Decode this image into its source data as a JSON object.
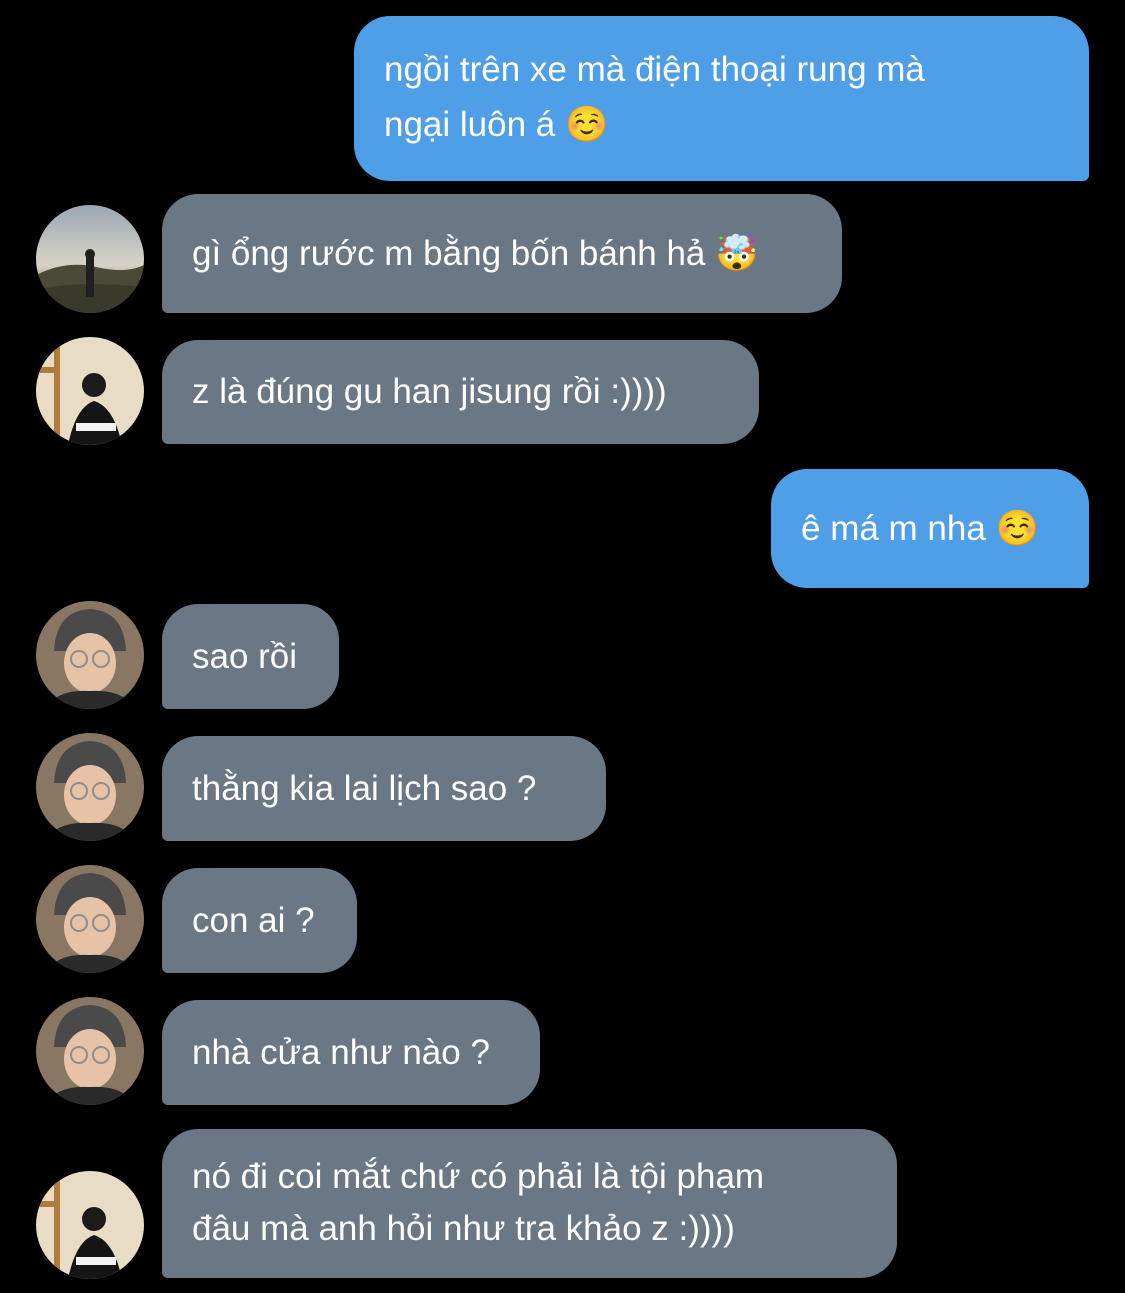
{
  "colors": {
    "background": "#000000",
    "outgoing_bubble": "#4f9fe8",
    "incoming_bubble": "#6a7785",
    "text": "#ffffff"
  },
  "messages": [
    {
      "direction": "outgoing",
      "lines": [
        "ngồi trên xe mà điện thoại rung mà",
        "ngại luôn á ☺️"
      ]
    },
    {
      "direction": "incoming",
      "avatar": "landscape-avatar",
      "lines": [
        "gì ổng rước m bằng bốn bánh hả 🤯"
      ]
    },
    {
      "direction": "incoming",
      "avatar": "mirror-selfie-avatar",
      "lines": [
        "z là đúng gu han jisung rồi :))))"
      ]
    },
    {
      "direction": "outgoing",
      "lines": [
        "ê má m nha ☺️"
      ]
    },
    {
      "direction": "incoming",
      "avatar": "beanie-glasses-avatar",
      "lines": [
        "sao rồi"
      ]
    },
    {
      "direction": "incoming",
      "avatar": "beanie-glasses-avatar",
      "lines": [
        "thằng kia lai lịch sao ?"
      ]
    },
    {
      "direction": "incoming",
      "avatar": "beanie-glasses-avatar",
      "lines": [
        "con ai ?"
      ]
    },
    {
      "direction": "incoming",
      "avatar": "beanie-glasses-avatar",
      "lines": [
        "nhà cửa như nào ?"
      ]
    },
    {
      "direction": "incoming",
      "avatar": "mirror-selfie-avatar",
      "lines": [
        "nó đi coi mắt chứ có phải là tội phạm",
        "đâu mà anh hỏi như tra khảo z :))))"
      ]
    }
  ]
}
